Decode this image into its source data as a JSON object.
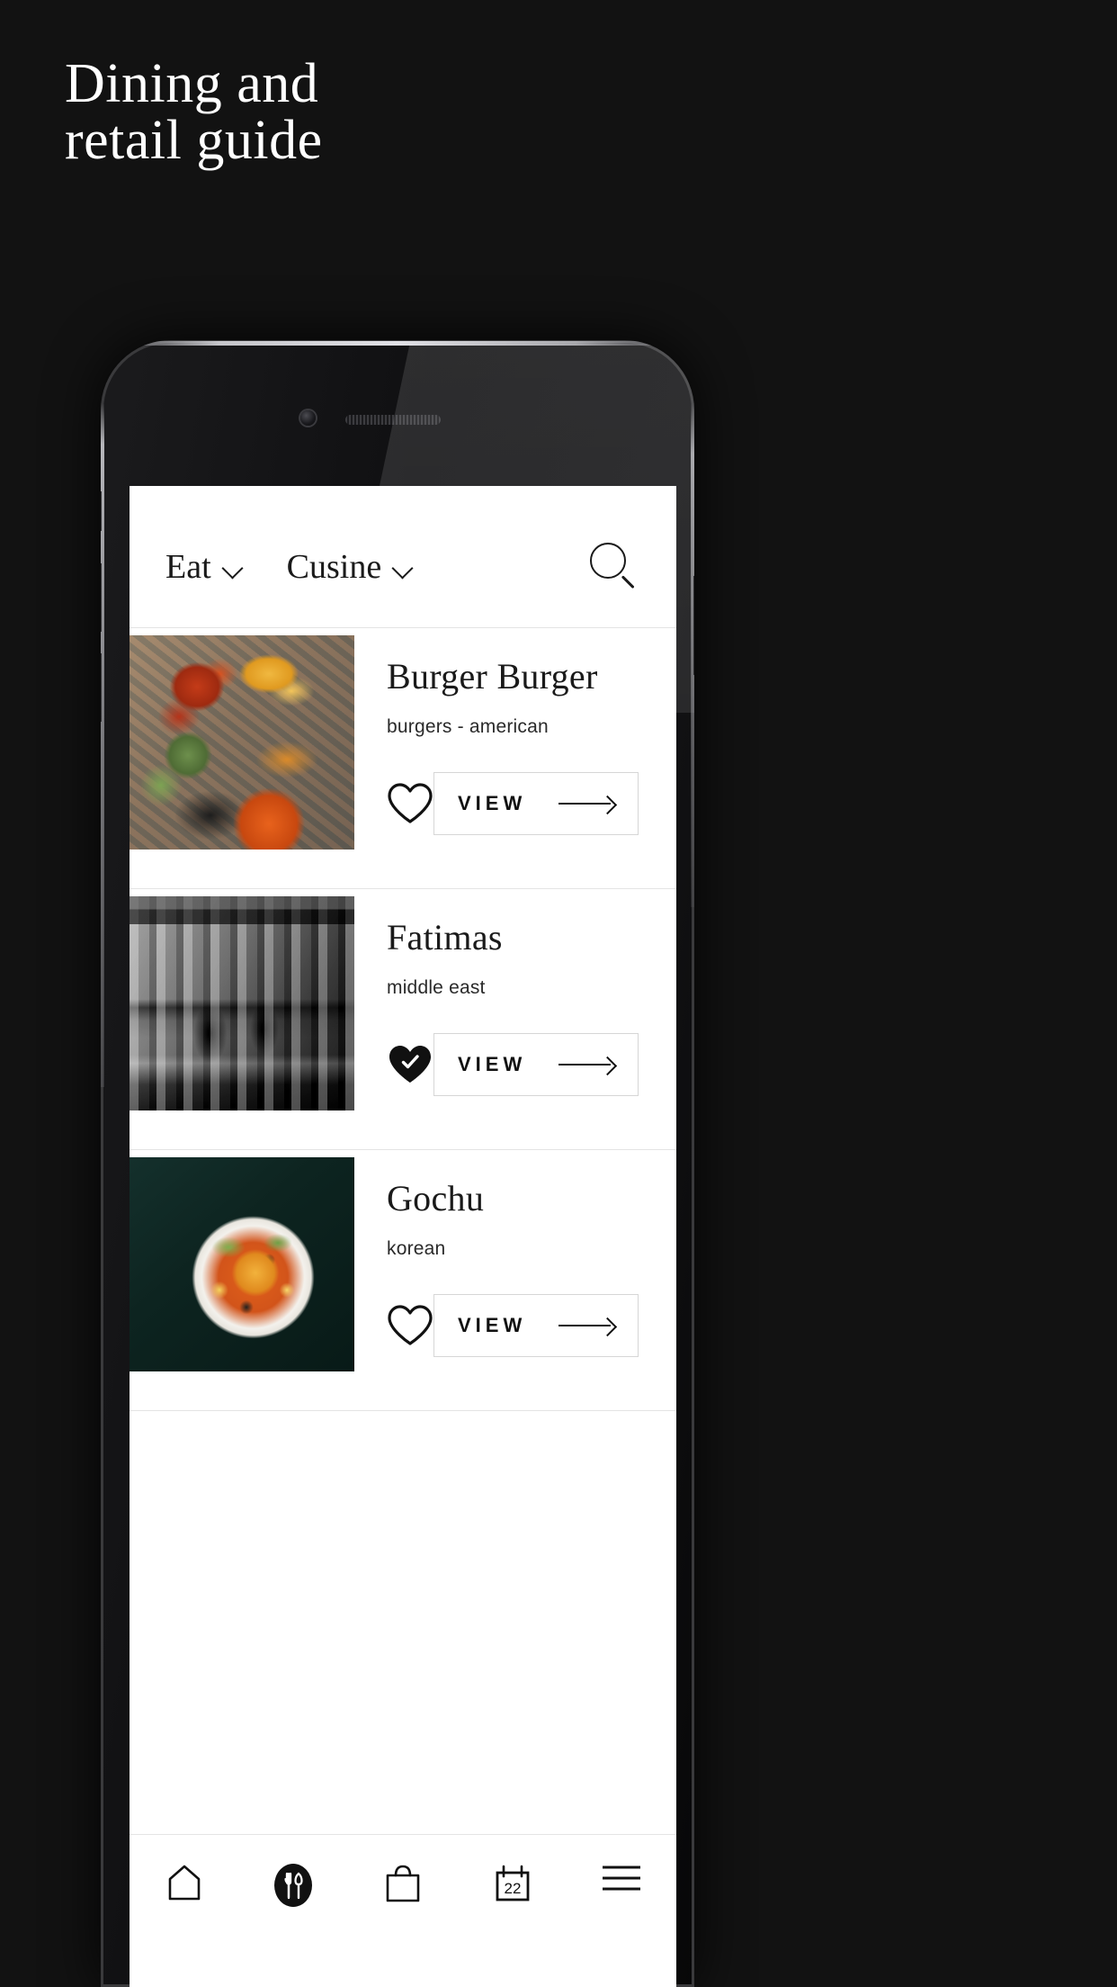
{
  "poster": {
    "headline": "Dining and\nretail guide",
    "background_color": "#121212",
    "text_color": "#ffffff"
  },
  "app": {
    "header": {
      "filters": [
        {
          "label": "Eat",
          "icon": "chevron-down-icon"
        },
        {
          "label": "Cusine",
          "icon": "chevron-down-icon"
        }
      ],
      "search_icon": "search-icon"
    },
    "listings": [
      {
        "name": "Burger Burger",
        "category": "burgers - american",
        "favorite": false,
        "favorite_icon": "heart-outline-icon",
        "action_label": "VIEW",
        "action_icon": "arrow-right-icon",
        "image": "plated-wings-fries-and-drinks-on-wooden-table"
      },
      {
        "name": "Fatimas",
        "category": "middle east",
        "favorite": true,
        "favorite_icon": "heart-filled-check-icon",
        "action_label": "VIEW",
        "action_icon": "arrow-right-icon",
        "image": "black-and-white-restaurant-kitchen"
      },
      {
        "name": "Gochu",
        "category": "korean",
        "favorite": false,
        "favorite_icon": "heart-outline-icon",
        "action_label": "VIEW",
        "action_icon": "arrow-right-icon",
        "image": "korean-seafood-stew-in-white-bowl"
      }
    ],
    "tabbar": {
      "items": [
        {
          "name": "home",
          "icon": "home-icon",
          "active": false
        },
        {
          "name": "eat",
          "icon": "cutlery-icon",
          "active": true
        },
        {
          "name": "shop",
          "icon": "shopping-bag-icon",
          "active": false
        },
        {
          "name": "events",
          "icon": "calendar-icon",
          "active": false,
          "badge": "22"
        },
        {
          "name": "menu",
          "icon": "hamburger-menu-icon",
          "active": false
        }
      ]
    }
  },
  "colors": {
    "background": "#121212",
    "screen": "#ffffff",
    "text": "#1a1a1a",
    "border": "#e4e4e4",
    "button_border": "#d6d6d6"
  }
}
